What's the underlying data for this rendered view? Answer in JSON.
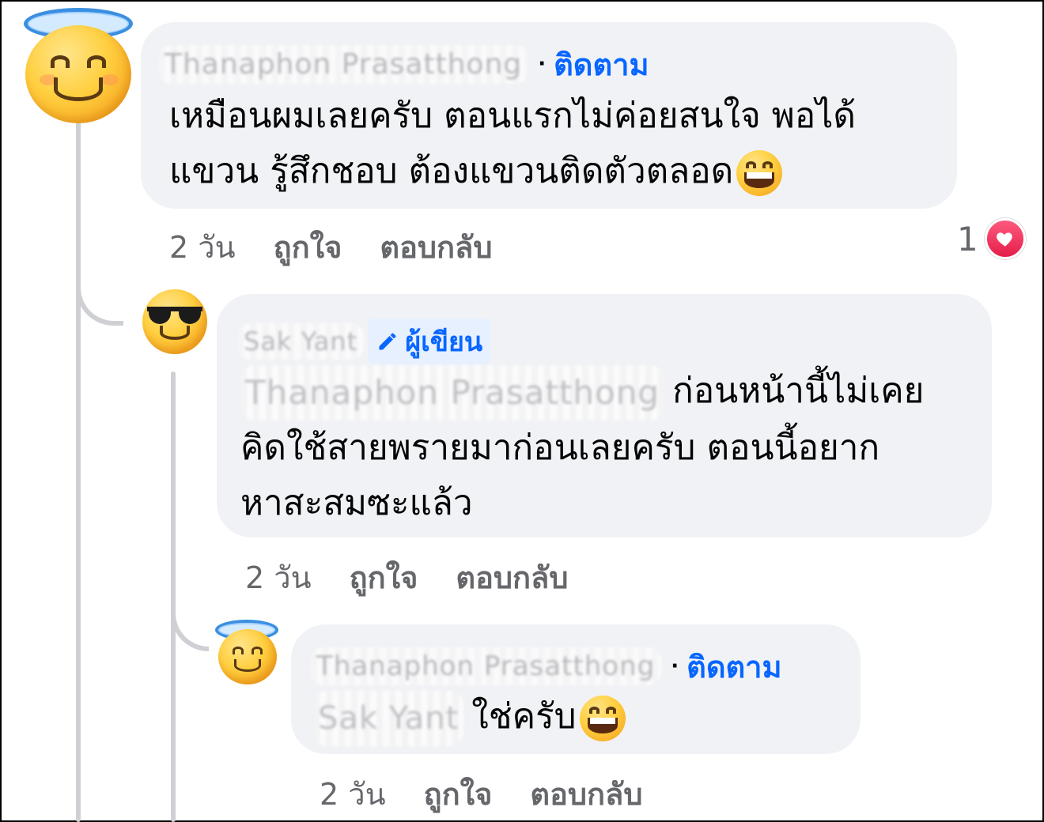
{
  "comments": [
    {
      "author": "Thanaphon Prasatthong",
      "follow_label": "ติดตาม",
      "text_lines": [
        "เหมือนผมเลยครับ ตอนแรกไม่ค่อยสนใจ พอได้",
        "แขวน รู้สึกชอบ ต้องแขวนติดตัวตลอด"
      ],
      "time": "2 วัน",
      "like_label": "ถูกใจ",
      "reply_label": "ตอบกลับ",
      "reaction_count": "1",
      "reaction_icon": "heart-icon",
      "avatar_icon": "halo-smile-emoji",
      "inline_emoji": "grinning-face-icon"
    },
    {
      "author": "Sak Yant",
      "author_badge": "ผู้เขียน",
      "badge_icon": "pencil-icon",
      "mention": "Thanaphon Prasatthong",
      "text_lines": [
        "ก่อนหน้านี้ไม่เคย",
        "คิดใช้สายพรายมาก่อนเลยครับ ตอนนี้อยาก",
        "หาสะสมซะแล้ว"
      ],
      "time": "2 วัน",
      "like_label": "ถูกใจ",
      "reply_label": "ตอบกลับ",
      "avatar_icon": "sunglasses-emoji"
    },
    {
      "author": "Thanaphon Prasatthong",
      "follow_label": "ติดตาม",
      "mention": "Sak Yant",
      "text": "ใช่ครับ",
      "time": "2 วัน",
      "like_label": "ถูกใจ",
      "reply_label": "ตอบกลับ",
      "avatar_icon": "halo-smile-emoji",
      "inline_emoji": "grinning-face-icon"
    }
  ],
  "colors": {
    "bubble": "#f0f2f5",
    "link_blue": "#0866ff",
    "meta_gray": "#65676b",
    "thread_line": "#ced0d4",
    "heart_red": "#e41e4a"
  }
}
